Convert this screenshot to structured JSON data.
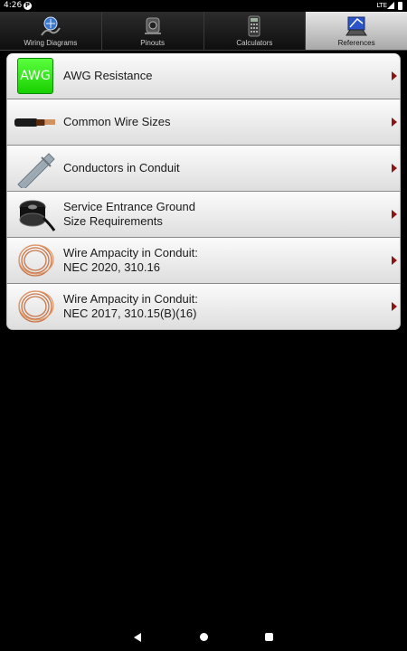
{
  "status_bar": {
    "time": "4:26",
    "app_icon": "P",
    "network": "LTE"
  },
  "tabs": [
    {
      "label": "Wiring Diagrams",
      "icon": "wiring-diagrams-icon",
      "active": false
    },
    {
      "label": "Pinouts",
      "icon": "pinouts-icon",
      "active": false
    },
    {
      "label": "Calculators",
      "icon": "calculator-icon",
      "active": false
    },
    {
      "label": "References",
      "icon": "references-icon",
      "active": true
    }
  ],
  "references": [
    {
      "line1": "AWG Resistance",
      "line2": "",
      "icon": "awg-icon",
      "icon_text": "AWG"
    },
    {
      "line1": "Common Wire Sizes",
      "line2": "",
      "icon": "wire-cable-icon"
    },
    {
      "line1": "Conductors in Conduit",
      "line2": "",
      "icon": "conduit-pipe-icon"
    },
    {
      "line1": "Service Entrance Ground",
      "line2": "Size Requirements",
      "icon": "wire-spool-icon"
    },
    {
      "line1": "Wire Ampacity in Conduit:",
      "line2": "NEC 2020, 310.16",
      "icon": "copper-coil-icon"
    },
    {
      "line1": "Wire Ampacity in Conduit:",
      "line2": "NEC 2017, 310.15(B)(16)",
      "icon": "copper-coil-icon"
    }
  ],
  "colors": {
    "accent_arrow": "#8b1414",
    "awg_green": "#2ee81a",
    "background": "#000000"
  }
}
